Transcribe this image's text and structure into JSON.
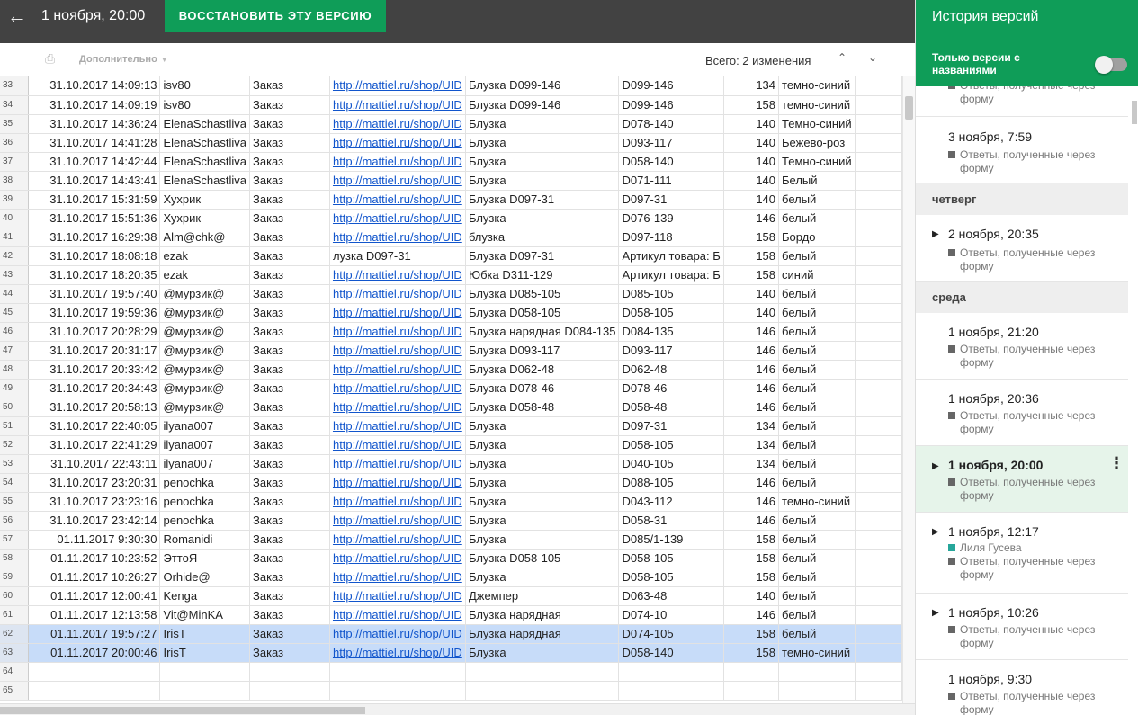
{
  "header": {
    "version_title": "1 ноября, 20:00",
    "restore_label": "ВОССТАНОВИТЬ ЭТУ ВЕРСИЮ",
    "back_icon": "arrow-left-icon"
  },
  "toolbar": {
    "more_label": "Дополнительно",
    "total_label": "Всего: 2 изменения"
  },
  "sheet": {
    "rows": [
      [
        "33",
        "31.10.2017 14:09:13",
        "isv80",
        "Заказ",
        "http://mattiel.ru/shop/UID",
        "Блузка D099-146",
        "D099-146",
        "134",
        "темно-синий"
      ],
      [
        "34",
        "31.10.2017 14:09:19",
        "isv80",
        "Заказ",
        "http://mattiel.ru/shop/UID",
        "Блузка D099-146",
        "D099-146",
        "158",
        "темно-синий"
      ],
      [
        "35",
        "31.10.2017 14:36:24",
        "ElenaSchastliva",
        "Заказ",
        "http://mattiel.ru/shop/UID",
        "Блузка",
        "D078-140",
        "140",
        "Темно-синий"
      ],
      [
        "36",
        "31.10.2017 14:41:28",
        "ElenaSchastliva",
        "Заказ",
        "http://mattiel.ru/shop/UID",
        "Блузка",
        "D093-117",
        "140",
        "Бежево-роз"
      ],
      [
        "37",
        "31.10.2017 14:42:44",
        "ElenaSchastliva",
        "Заказ",
        "http://mattiel.ru/shop/UID",
        "Блузка",
        "D058-140",
        "140",
        "Темно-синий"
      ],
      [
        "38",
        "31.10.2017 14:43:41",
        "ElenaSchastliva",
        "Заказ",
        "http://mattiel.ru/shop/UID",
        "Блузка",
        "D071-111",
        "140",
        "Белый"
      ],
      [
        "39",
        "31.10.2017 15:31:59",
        "Хухрик",
        "Заказ",
        "http://mattiel.ru/shop/UID",
        "Блузка D097-31",
        "D097-31",
        "140",
        "белый"
      ],
      [
        "40",
        "31.10.2017 15:51:36",
        "Хухрик",
        "Заказ",
        "http://mattiel.ru/shop/UID",
        "Блузка",
        "D076-139",
        "146",
        "белый"
      ],
      [
        "41",
        "31.10.2017 16:29:38",
        "Alm@chk@",
        "Заказ",
        "http://mattiel.ru/shop/UID",
        "блузка",
        "D097-118",
        "158",
        "Бордо"
      ],
      [
        "42",
        "31.10.2017 18:08:18",
        "ezak",
        "Заказ",
        "лузка D097-31",
        "Блузка D097-31",
        "Артикул товара: Б",
        "158",
        "белый"
      ],
      [
        "43",
        "31.10.2017 18:20:35",
        "ezak",
        "Заказ",
        "http://mattiel.ru/shop/UID",
        "Юбка D311-129",
        "Артикул товара: Б",
        "158",
        "синий"
      ],
      [
        "44",
        "31.10.2017 19:57:40",
        "@мурзик@",
        "Заказ",
        "http://mattiel.ru/shop/UID",
        "Блузка D085-105",
        "D085-105",
        "140",
        "белый"
      ],
      [
        "45",
        "31.10.2017 19:59:36",
        "@мурзик@",
        "Заказ",
        "http://mattiel.ru/shop/UID",
        "Блузка D058-105",
        "D058-105",
        "140",
        "белый"
      ],
      [
        "46",
        "31.10.2017 20:28:29",
        "@мурзик@",
        "Заказ",
        "http://mattiel.ru/shop/UID",
        "Блузка нарядная D084-135",
        "D084-135",
        "146",
        "белый"
      ],
      [
        "47",
        "31.10.2017 20:31:17",
        "@мурзик@",
        "Заказ",
        "http://mattiel.ru/shop/UID",
        "Блузка D093-117",
        "D093-117",
        "146",
        "белый"
      ],
      [
        "48",
        "31.10.2017 20:33:42",
        "@мурзик@",
        "Заказ",
        "http://mattiel.ru/shop/UID",
        "Блузка D062-48",
        "D062-48",
        "146",
        "белый"
      ],
      [
        "49",
        "31.10.2017 20:34:43",
        "@мурзик@",
        "Заказ",
        "http://mattiel.ru/shop/UID",
        "Блузка D078-46",
        "D078-46",
        "146",
        "белый"
      ],
      [
        "50",
        "31.10.2017 20:58:13",
        "@мурзик@",
        "Заказ",
        "http://mattiel.ru/shop/UID",
        "Блузка D058-48",
        "D058-48",
        "146",
        "белый"
      ],
      [
        "51",
        "31.10.2017 22:40:05",
        "ilyana007",
        "Заказ",
        "http://mattiel.ru/shop/UID",
        "Блузка",
        "D097-31",
        "134",
        "белый"
      ],
      [
        "52",
        "31.10.2017 22:41:29",
        "ilyana007",
        "Заказ",
        "http://mattiel.ru/shop/UID",
        "Блузка",
        "D058-105",
        "134",
        "белый"
      ],
      [
        "53",
        "31.10.2017 22:43:11",
        "ilyana007",
        "Заказ",
        "http://mattiel.ru/shop/UID",
        "Блузка",
        "D040-105",
        "134",
        "белый"
      ],
      [
        "54",
        "31.10.2017 23:20:31",
        "penochka",
        "Заказ",
        "http://mattiel.ru/shop/UID",
        "Блузка",
        "D088-105",
        "146",
        "белый"
      ],
      [
        "55",
        "31.10.2017 23:23:16",
        "penochka",
        "Заказ",
        "http://mattiel.ru/shop/UID",
        "Блузка",
        "D043-112",
        "146",
        "темно-синий"
      ],
      [
        "56",
        "31.10.2017 23:42:14",
        "penochka",
        "Заказ",
        "http://mattiel.ru/shop/UID",
        "Блузка",
        "D058-31",
        "146",
        "белый"
      ],
      [
        "57",
        "01.11.2017 9:30:30",
        "Romanidi",
        "Заказ",
        "http://mattiel.ru/shop/UID",
        "Блузка",
        "D085/1-139",
        "158",
        "белый"
      ],
      [
        "58",
        "01.11.2017 10:23:52",
        "ЭттоЯ",
        "Заказ",
        "http://mattiel.ru/shop/UID",
        "Блузка D058-105",
        "D058-105",
        "158",
        "белый"
      ],
      [
        "59",
        "01.11.2017 10:26:27",
        "Orhide@",
        "Заказ",
        "http://mattiel.ru/shop/UID",
        "Блузка",
        "D058-105",
        "158",
        "белый"
      ],
      [
        "60",
        "01.11.2017 12:00:41",
        "Kenga",
        "Заказ",
        "http://mattiel.ru/shop/UID",
        "Джемпер",
        "D063-48",
        "140",
        "белый"
      ],
      [
        "61",
        "01.11.2017 12:13:58",
        "Vit@MinKA",
        "Заказ",
        "http://mattiel.ru/shop/UID",
        "Блузка нарядная",
        "D074-10",
        "146",
        "белый"
      ],
      [
        "62",
        "01.11.2017 19:57:27",
        "IrisT",
        "Заказ",
        "http://mattiel.ru/shop/UID",
        "Блузка нарядная",
        "D074-105",
        "158",
        "белый"
      ],
      [
        "63",
        "01.11.2017 20:00:46",
        "IrisT",
        "Заказ",
        "http://mattiel.ru/shop/UID",
        "Блузка",
        "D058-140",
        "158",
        "темно-синий"
      ],
      [
        "64",
        "",
        "",
        "",
        "",
        "",
        "",
        "",
        ""
      ],
      [
        "65",
        "",
        "",
        "",
        "",
        "",
        "",
        "",
        ""
      ]
    ],
    "selected_rows": [
      "62",
      "63"
    ]
  },
  "panel": {
    "title": "История версий",
    "filter_label_1": "Только версии с",
    "filter_label_2": "названиями",
    "days": {
      "thursday": "четверг",
      "wednesday": "среда"
    },
    "form_label_1": "Ответы, полученные через",
    "form_label_2": "форму",
    "entries": {
      "e0_time": "3 ноября, 7:59",
      "e1_time": "2 ноября, 20:35",
      "e2_time": "1 ноября, 21:20",
      "e3_time": "1 ноября, 20:36",
      "e4_time": "1 ноября, 20:00",
      "e5_time": "1 ноября, 12:17",
      "e5_user": "Лиля Гусева",
      "e6_time": "1 ноября, 10:26",
      "e7_time": "1 ноября, 9:30"
    },
    "accent": "#0f9d58",
    "user_color": "#26a69a"
  }
}
